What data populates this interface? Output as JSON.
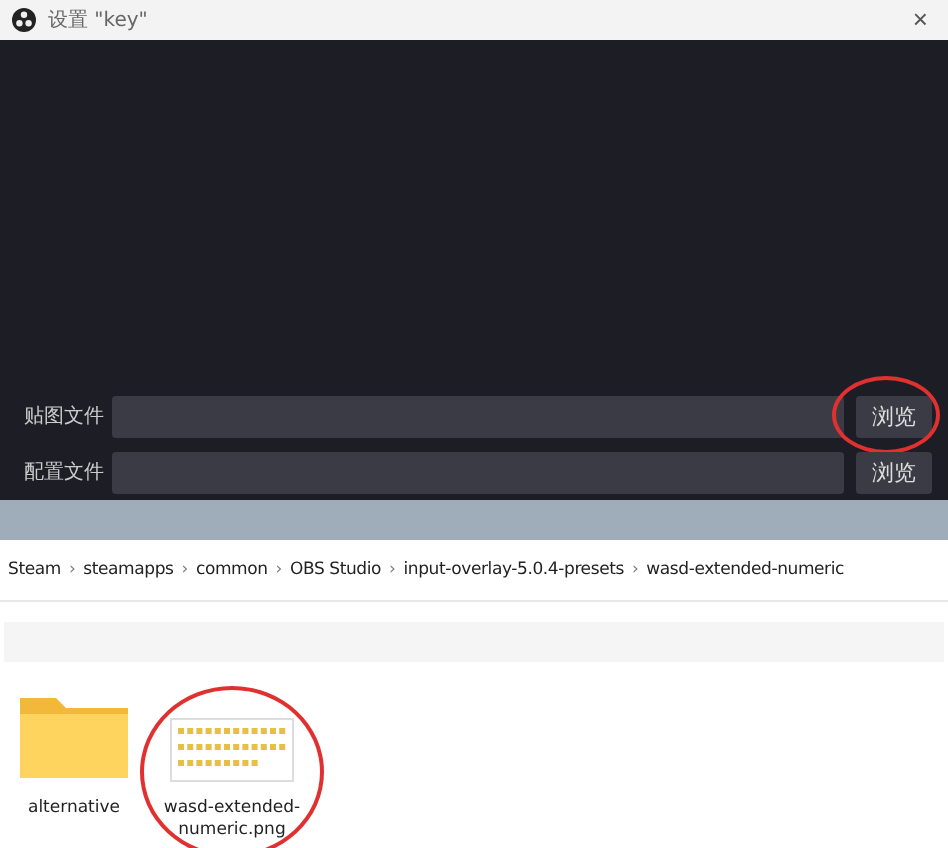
{
  "dialog": {
    "title": "设置 \"key\"",
    "close": "×",
    "fields": [
      {
        "label": "贴图文件",
        "button": "浏览",
        "annotated": true
      },
      {
        "label": "配置文件",
        "button": "浏览",
        "annotated": false
      }
    ]
  },
  "explorer": {
    "breadcrumb": [
      "Steam",
      "steamapps",
      "common",
      "OBS Studio",
      "input-overlay-5.0.4-presets",
      "wasd-extended-numeric"
    ],
    "separator": "›",
    "files": [
      {
        "kind": "folder",
        "name": "alternative",
        "annotated": false
      },
      {
        "kind": "image",
        "name": "wasd-extended-numeric.png",
        "annotated": true
      }
    ]
  }
}
